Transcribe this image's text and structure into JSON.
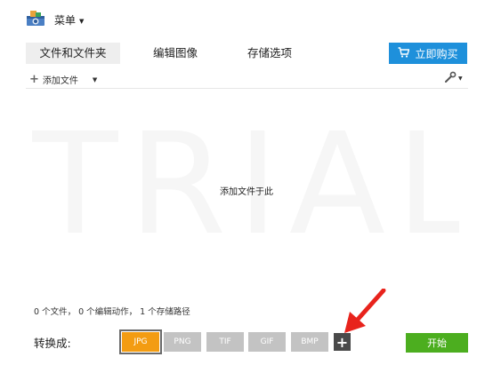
{
  "menu": {
    "label": "菜单"
  },
  "tabs": [
    {
      "label": "文件和文件夹"
    },
    {
      "label": "编辑图像"
    },
    {
      "label": "存储选项"
    }
  ],
  "buy": {
    "label": "立即购买"
  },
  "toolbar": {
    "add_file_label": "添加文件"
  },
  "dropzone": {
    "watermark": "TRIAL",
    "hint": "添加文件于此"
  },
  "status": {
    "text": "0 个文件， 0 个编辑动作， 1 个存储路径"
  },
  "bottom": {
    "convert_label": "转换成:",
    "formats": [
      {
        "label": "JPG",
        "selected": true
      },
      {
        "label": "PNG",
        "selected": false
      },
      {
        "label": "TIF",
        "selected": false
      },
      {
        "label": "GIF",
        "selected": false
      },
      {
        "label": "BMP",
        "selected": false
      }
    ],
    "add_format_label": "+",
    "start_label": "开始"
  },
  "colors": {
    "buy_button": "#1e90db",
    "selected_format": "#f39c12",
    "format_inactive": "#c3c3c3",
    "start_button": "#4cae1f",
    "annotation_arrow": "#e8231c"
  }
}
